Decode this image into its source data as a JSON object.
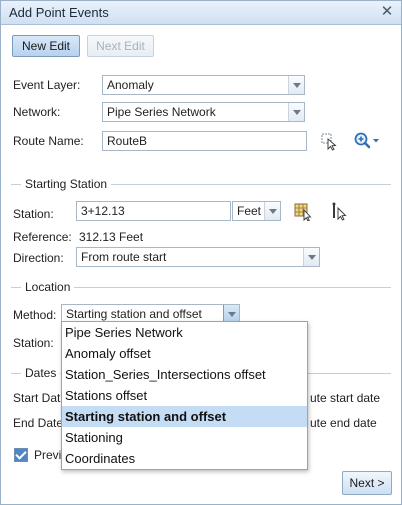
{
  "window": {
    "title": "Add Point Events"
  },
  "toolbar": {
    "new_edit": "New Edit",
    "next_edit": "Next Edit"
  },
  "form": {
    "event_layer_label": "Event Layer:",
    "event_layer_value": "Anomaly",
    "network_label": "Network:",
    "network_value": "Pipe Series Network",
    "route_name_label": "Route Name:",
    "route_name_value": "RouteB"
  },
  "starting_station": {
    "title": "Starting Station",
    "station_label": "Station:",
    "station_value": "3+12.13",
    "units_value": "Feet",
    "reference_label": "Reference:",
    "reference_value": "312.13 Feet",
    "direction_label": "Direction:",
    "direction_value": "From route start"
  },
  "location": {
    "title": "Location",
    "method_label": "Method:",
    "method_value": "Starting station and offset",
    "station_label": "Station:",
    "options": [
      "Pipe Series Network",
      "Anomaly offset",
      "Station_Series_Intersections offset",
      "Stations offset",
      "Starting station and offset",
      "Stationing",
      "Coordinates"
    ],
    "selected_index": 4
  },
  "dates": {
    "title": "Dates",
    "start_label_partial": "Start Dat",
    "end_label_partial": "End Date",
    "start_suffix": "ute start date",
    "end_suffix": "ute end date"
  },
  "preview": {
    "label_partial": "Previ",
    "checked": true
  },
  "footer": {
    "next_label": "Next >"
  },
  "icons": {
    "close": "close-icon",
    "route_select": "select-route-icon",
    "zoom": "zoom-icon",
    "station_pick": "pick-station-icon",
    "identify": "identify-icon"
  }
}
